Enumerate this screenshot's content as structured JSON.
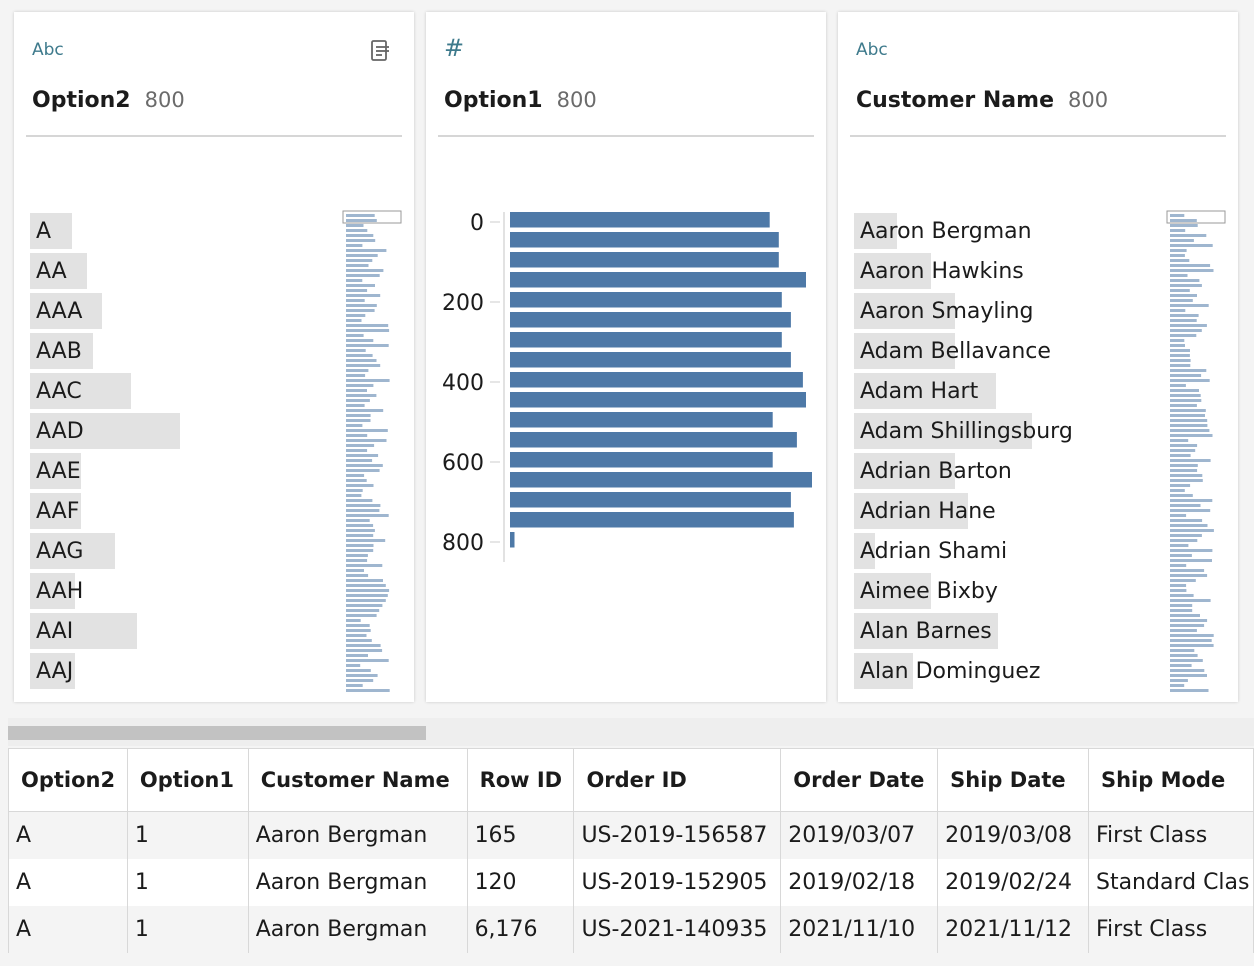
{
  "profile_cards": [
    {
      "type_label": "Abc",
      "field_name": "Option2",
      "count": "800",
      "values": [
        "A",
        "AA",
        "AAA",
        "AAB",
        "AAC",
        "AAD",
        "AAE",
        "AAF",
        "AAG",
        "AAH",
        "AAI",
        "AAJ"
      ],
      "value_fractions": [
        0.28,
        0.38,
        0.48,
        0.42,
        0.67,
        1.0,
        0.34,
        0.34,
        0.57,
        0.3,
        0.71,
        0.3
      ]
    },
    {
      "type_label": "#",
      "field_name": "Option1",
      "count": "800"
    },
    {
      "type_label": "Abc",
      "field_name": "Customer Name",
      "count": "800",
      "values": [
        "Aaron Bergman",
        "Aaron Hawkins",
        "Aaron Smayling",
        "Adam Bellavance",
        "Adam Hart",
        "Adam Shillingsburg",
        "Adrian Barton",
        "Adrian Hane",
        "Adrian Shami",
        "Aimee Bixby",
        "Alan Barnes",
        "Alan Dominguez"
      ],
      "value_fractions": [
        0.24,
        0.43,
        0.57,
        0.57,
        0.8,
        1.0,
        0.57,
        0.64,
        0.12,
        0.43,
        0.81,
        0.33
      ]
    }
  ],
  "chart_data": {
    "type": "bar",
    "orientation": "horizontal",
    "title": "",
    "xlabel": "",
    "ylabel": "",
    "y_ticks": [
      "0",
      "200",
      "400",
      "600",
      "800"
    ],
    "ylim": [
      0,
      850
    ],
    "bins": [
      0,
      50,
      100,
      150,
      200,
      250,
      300,
      350,
      400,
      450,
      500,
      550,
      600,
      650,
      700,
      750,
      800
    ],
    "values": [
      0.86,
      0.89,
      0.89,
      0.98,
      0.9,
      0.93,
      0.9,
      0.93,
      0.97,
      0.98,
      0.87,
      0.95,
      0.87,
      1.0,
      0.93,
      0.94,
      0.015
    ],
    "bar_color": "#4e79a7"
  },
  "table": {
    "columns": [
      "Option2",
      "Option1",
      "Customer Name",
      "Row ID",
      "Order ID",
      "Order Date",
      "Ship Date",
      "Ship Mode"
    ],
    "rows": [
      [
        "A",
        "1",
        "Aaron Bergman",
        "165",
        "US-2019-156587",
        "2019/03/07",
        "2019/03/08",
        "First Class"
      ],
      [
        "A",
        "1",
        "Aaron Bergman",
        "120",
        "US-2019-152905",
        "2019/02/18",
        "2019/02/24",
        "Standard Clas"
      ],
      [
        "A",
        "1",
        "Aaron Bergman",
        "6,176",
        "US-2021-140935",
        "2021/11/10",
        "2021/11/12",
        "First Class"
      ]
    ]
  },
  "colors": {
    "accent": "#3e7a8c",
    "bar": "#4e79a7",
    "spark": "#9fb6cf"
  }
}
